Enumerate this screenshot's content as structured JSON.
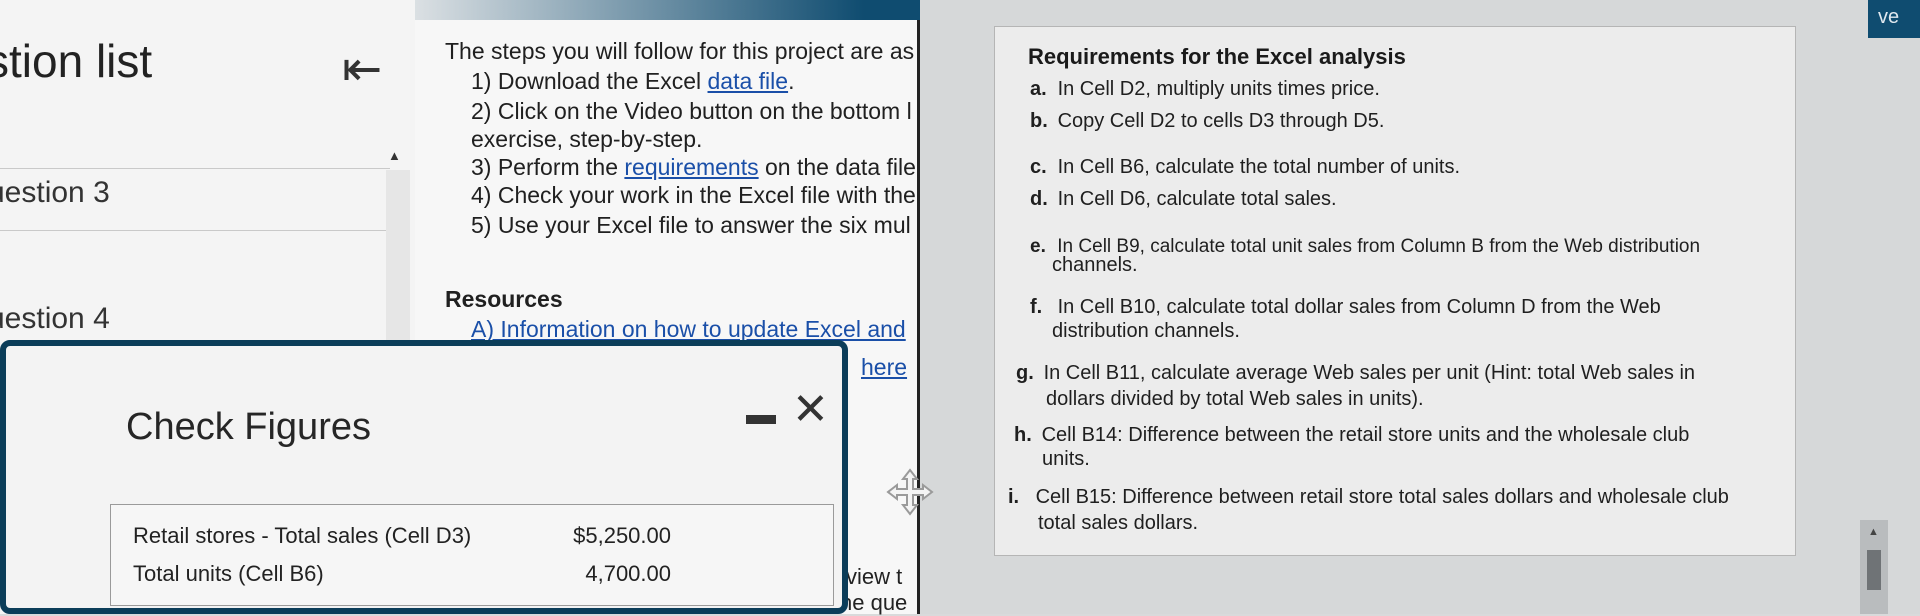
{
  "question_list": {
    "title": "stion list",
    "collapse_icon": "collapse-left-icon",
    "items": [
      "uestion 3",
      "uestion 4"
    ]
  },
  "steps": {
    "intro": "The steps you will follow for this project are as",
    "items": [
      {
        "prefix": "1) Download the Excel ",
        "link": "data file",
        "suffix": "."
      },
      {
        "prefix": "2) Click on the Video button on the bottom l",
        "link": "",
        "suffix": ""
      },
      {
        "prefix": "exercise, step-by-step.",
        "link": "",
        "suffix": ""
      },
      {
        "prefix": "3) Perform the ",
        "link": "requirements",
        "suffix": " on the data file"
      },
      {
        "prefix": "4) Check your work in the Excel file with the",
        "link": "",
        "suffix": ""
      },
      {
        "prefix": "5) Use your Excel file to answer the six mul",
        "link": "",
        "suffix": ""
      }
    ],
    "resources_title": "Resources",
    "resource_link": "A) Information on how to update Excel and",
    "resource_link2": "here",
    "view_fragment": "view t",
    "que_fragment": "he que"
  },
  "requirements": {
    "title": "Requirements for the Excel analysis",
    "items": [
      {
        "letter": "a.",
        "text": "In Cell D2, multiply units times price.",
        "cont": ""
      },
      {
        "letter": "b.",
        "text": "Copy Cell D2 to cells D3 through D5.",
        "cont": ""
      },
      {
        "letter": "c.",
        "text": "In Cell B6, calculate the total number of units.",
        "cont": ""
      },
      {
        "letter": "d.",
        "text": "In Cell D6, calculate total sales.",
        "cont": ""
      },
      {
        "letter": "e.",
        "text": "In Cell B9, calculate total unit sales from Column B from the Web distribution",
        "cont": "channels."
      },
      {
        "letter": "f.",
        "text": "In Cell B10, calculate total dollar sales from Column D from the Web",
        "cont": "distribution channels."
      },
      {
        "letter": "g.",
        "text": "In Cell B11, calculate average Web sales per unit (Hint: total Web sales in",
        "cont": "dollars divided by total Web sales in units)."
      },
      {
        "letter": "h.",
        "text": "Cell B14: Difference between the retail store units and the wholesale club",
        "cont": "units."
      },
      {
        "letter": "i.",
        "text": "Cell B15: Difference between retail store total sales dollars and wholesale club",
        "cont": "total sales dollars."
      }
    ],
    "corner_button": "ve"
  },
  "check_figures": {
    "title": "Check Figures",
    "minimize_icon": "minimize-icon",
    "close_icon": "close-icon",
    "rows": [
      {
        "label": "Retail stores - Total sales (Cell D3)",
        "value": "$5,250.00"
      },
      {
        "label": "Total units (Cell B6)",
        "value": "4,700.00"
      }
    ]
  },
  "colors": {
    "dialog_border": "#0b3d59",
    "link": "#1a4fa8",
    "header_blue": "#0f4c70"
  }
}
